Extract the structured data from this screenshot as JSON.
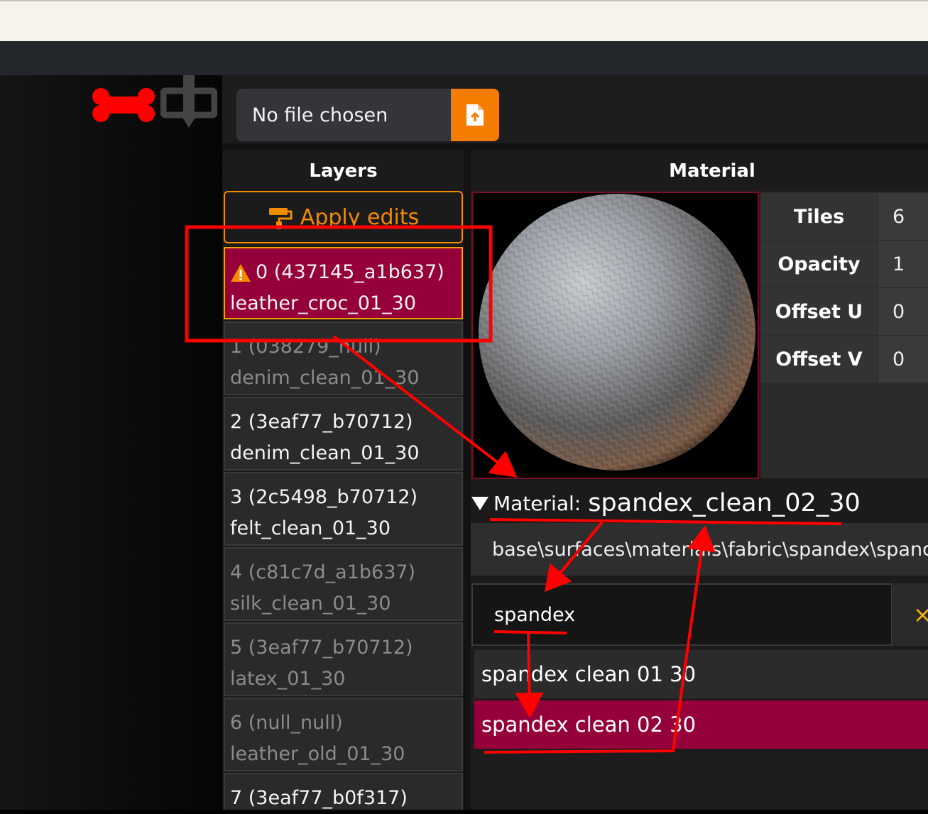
{
  "file_input": {
    "text": "No file chosen"
  },
  "layers": {
    "title": "Layers",
    "apply_label": "Apply edits",
    "items": [
      {
        "id": "0 (437145_a1b637)",
        "name": "leather_croc_01_30",
        "warning": true
      },
      {
        "id": "1 (038279_null)",
        "name": "denim_clean_01_30"
      },
      {
        "id": "2 (3eaf77_b70712)",
        "name": "denim_clean_01_30"
      },
      {
        "id": "3 (2c5498_b70712)",
        "name": "felt_clean_01_30"
      },
      {
        "id": "4 (c81c7d_a1b637)",
        "name": "silk_clean_01_30"
      },
      {
        "id": "5 (3eaf77_b70712)",
        "name": "latex_01_30"
      },
      {
        "id": "6 (null_null)",
        "name": "leather_old_01_30"
      },
      {
        "id": "7 (3eaf77_b0f317)",
        "name": ""
      }
    ]
  },
  "material": {
    "title": "Material",
    "props": [
      {
        "label": "Tiles",
        "value": "6"
      },
      {
        "label": "Opacity",
        "value": "1"
      },
      {
        "label": "Offset U",
        "value": "0"
      },
      {
        "label": "Offset V",
        "value": "0"
      }
    ],
    "header_prefix": "Material:",
    "header_name": "spandex_clean_02_30",
    "path": "base\\surfaces\\materials\\fabric\\spandex\\spandex",
    "search_value": "spandex",
    "clear_icon": "×",
    "results": [
      {
        "label": "spandex clean 01 30"
      },
      {
        "label": "spandex clean 02 30"
      }
    ]
  },
  "colors": {
    "accent_orange": "#f47c00",
    "selected_crimson": "#96003a",
    "warning_yellow": "#f2a000",
    "annotation_red": "#ff0000"
  }
}
